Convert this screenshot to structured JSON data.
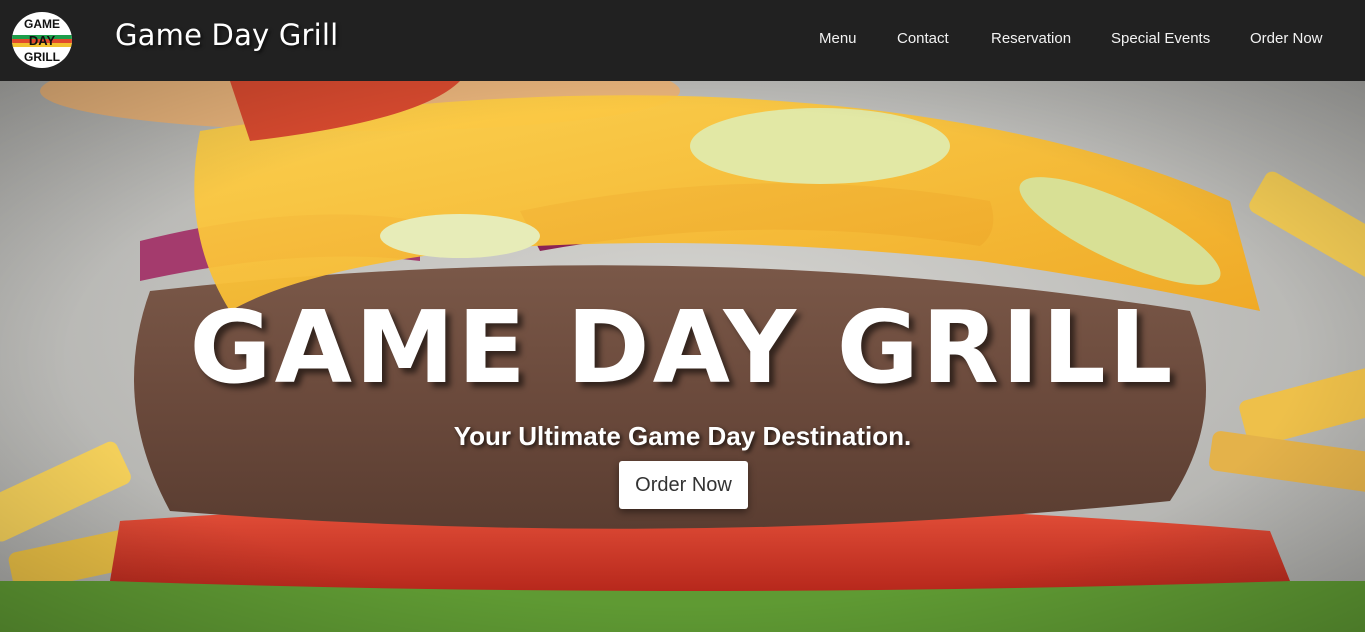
{
  "header": {
    "logo_text": [
      "GAME",
      "DAY",
      "GRILL"
    ],
    "logo_icon": "game-day-grill-logo",
    "brand": "Game Day Grill",
    "nav": [
      {
        "label": "Menu"
      },
      {
        "label": "Contact"
      },
      {
        "label": "Reservation"
      },
      {
        "label": "Special Events"
      },
      {
        "label": "Order Now"
      }
    ]
  },
  "hero": {
    "background": "burger-photo",
    "title": "GAME DAY GRILL",
    "subtitle": "Your Ultimate Game Day Destination.",
    "cta_label": "Order Now"
  },
  "colors": {
    "navbar": "#212121",
    "text": "#ffffff",
    "logo_stripes": [
      "#1e9e4b",
      "#e24a2a",
      "#f2c12e"
    ]
  }
}
